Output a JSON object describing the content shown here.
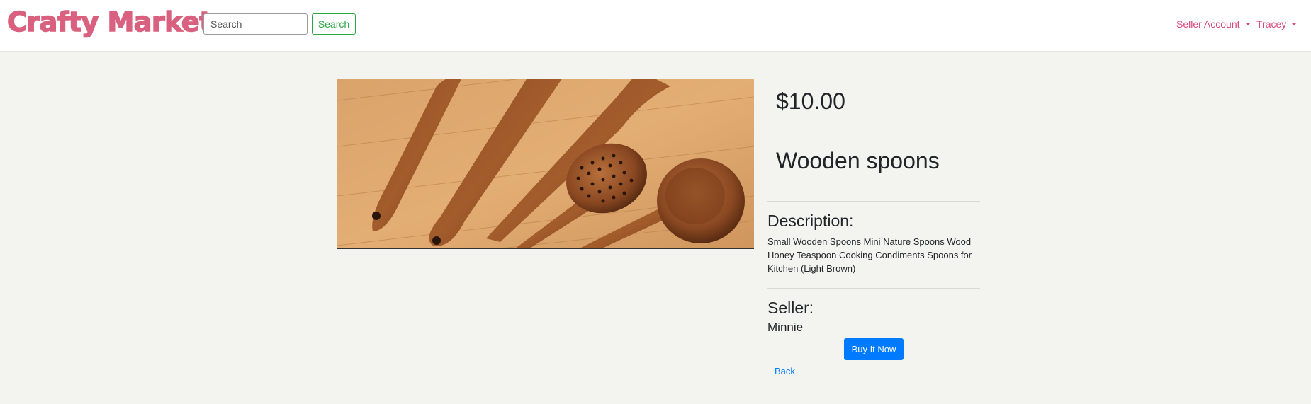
{
  "navbar": {
    "brand": "Crafty Market",
    "search_placeholder": "Search",
    "search_button": "Search",
    "seller_menu": "Seller Account",
    "user_menu": "Tracey"
  },
  "product": {
    "image_icon": "wooden-spoons-photo",
    "price": "$10.00",
    "title": "Wooden spoons",
    "description_heading": "Description:",
    "description": "Small Wooden Spoons Mini Nature Spoons Wood Honey Teaspoon Cooking Condiments Spoons for Kitchen (Light Brown)",
    "seller_heading": "Seller:",
    "seller_name": "Minnie",
    "buy_button": "Buy It Now",
    "back_link": "Back"
  },
  "colors": {
    "brand": "#d9617f",
    "nav_link": "#d9467a",
    "primary": "#007bff",
    "success": "#28a745",
    "background": "#f3f3ef"
  }
}
